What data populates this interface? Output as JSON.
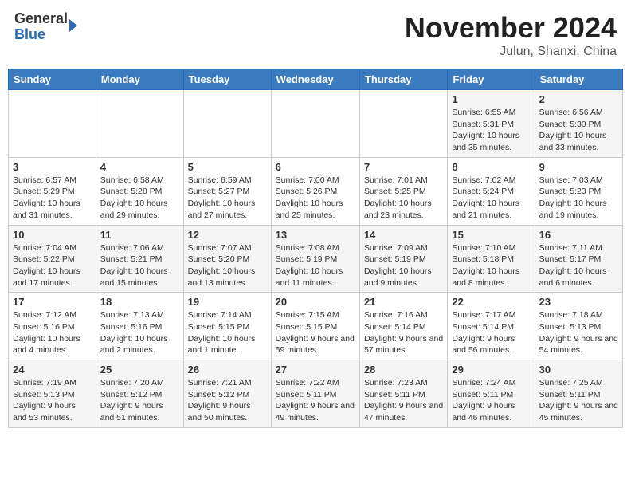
{
  "header": {
    "logo_general": "General",
    "logo_blue": "Blue",
    "month_title": "November 2024",
    "location": "Julun, Shanxi, China"
  },
  "days_of_week": [
    "Sunday",
    "Monday",
    "Tuesday",
    "Wednesday",
    "Thursday",
    "Friday",
    "Saturday"
  ],
  "weeks": [
    [
      {
        "day": "",
        "info": ""
      },
      {
        "day": "",
        "info": ""
      },
      {
        "day": "",
        "info": ""
      },
      {
        "day": "",
        "info": ""
      },
      {
        "day": "",
        "info": ""
      },
      {
        "day": "1",
        "info": "Sunrise: 6:55 AM\nSunset: 5:31 PM\nDaylight: 10 hours and 35 minutes."
      },
      {
        "day": "2",
        "info": "Sunrise: 6:56 AM\nSunset: 5:30 PM\nDaylight: 10 hours and 33 minutes."
      }
    ],
    [
      {
        "day": "3",
        "info": "Sunrise: 6:57 AM\nSunset: 5:29 PM\nDaylight: 10 hours and 31 minutes."
      },
      {
        "day": "4",
        "info": "Sunrise: 6:58 AM\nSunset: 5:28 PM\nDaylight: 10 hours and 29 minutes."
      },
      {
        "day": "5",
        "info": "Sunrise: 6:59 AM\nSunset: 5:27 PM\nDaylight: 10 hours and 27 minutes."
      },
      {
        "day": "6",
        "info": "Sunrise: 7:00 AM\nSunset: 5:26 PM\nDaylight: 10 hours and 25 minutes."
      },
      {
        "day": "7",
        "info": "Sunrise: 7:01 AM\nSunset: 5:25 PM\nDaylight: 10 hours and 23 minutes."
      },
      {
        "day": "8",
        "info": "Sunrise: 7:02 AM\nSunset: 5:24 PM\nDaylight: 10 hours and 21 minutes."
      },
      {
        "day": "9",
        "info": "Sunrise: 7:03 AM\nSunset: 5:23 PM\nDaylight: 10 hours and 19 minutes."
      }
    ],
    [
      {
        "day": "10",
        "info": "Sunrise: 7:04 AM\nSunset: 5:22 PM\nDaylight: 10 hours and 17 minutes."
      },
      {
        "day": "11",
        "info": "Sunrise: 7:06 AM\nSunset: 5:21 PM\nDaylight: 10 hours and 15 minutes."
      },
      {
        "day": "12",
        "info": "Sunrise: 7:07 AM\nSunset: 5:20 PM\nDaylight: 10 hours and 13 minutes."
      },
      {
        "day": "13",
        "info": "Sunrise: 7:08 AM\nSunset: 5:19 PM\nDaylight: 10 hours and 11 minutes."
      },
      {
        "day": "14",
        "info": "Sunrise: 7:09 AM\nSunset: 5:19 PM\nDaylight: 10 hours and 9 minutes."
      },
      {
        "day": "15",
        "info": "Sunrise: 7:10 AM\nSunset: 5:18 PM\nDaylight: 10 hours and 8 minutes."
      },
      {
        "day": "16",
        "info": "Sunrise: 7:11 AM\nSunset: 5:17 PM\nDaylight: 10 hours and 6 minutes."
      }
    ],
    [
      {
        "day": "17",
        "info": "Sunrise: 7:12 AM\nSunset: 5:16 PM\nDaylight: 10 hours and 4 minutes."
      },
      {
        "day": "18",
        "info": "Sunrise: 7:13 AM\nSunset: 5:16 PM\nDaylight: 10 hours and 2 minutes."
      },
      {
        "day": "19",
        "info": "Sunrise: 7:14 AM\nSunset: 5:15 PM\nDaylight: 10 hours and 1 minute."
      },
      {
        "day": "20",
        "info": "Sunrise: 7:15 AM\nSunset: 5:15 PM\nDaylight: 9 hours and 59 minutes."
      },
      {
        "day": "21",
        "info": "Sunrise: 7:16 AM\nSunset: 5:14 PM\nDaylight: 9 hours and 57 minutes."
      },
      {
        "day": "22",
        "info": "Sunrise: 7:17 AM\nSunset: 5:14 PM\nDaylight: 9 hours and 56 minutes."
      },
      {
        "day": "23",
        "info": "Sunrise: 7:18 AM\nSunset: 5:13 PM\nDaylight: 9 hours and 54 minutes."
      }
    ],
    [
      {
        "day": "24",
        "info": "Sunrise: 7:19 AM\nSunset: 5:13 PM\nDaylight: 9 hours and 53 minutes."
      },
      {
        "day": "25",
        "info": "Sunrise: 7:20 AM\nSunset: 5:12 PM\nDaylight: 9 hours and 51 minutes."
      },
      {
        "day": "26",
        "info": "Sunrise: 7:21 AM\nSunset: 5:12 PM\nDaylight: 9 hours and 50 minutes."
      },
      {
        "day": "27",
        "info": "Sunrise: 7:22 AM\nSunset: 5:11 PM\nDaylight: 9 hours and 49 minutes."
      },
      {
        "day": "28",
        "info": "Sunrise: 7:23 AM\nSunset: 5:11 PM\nDaylight: 9 hours and 47 minutes."
      },
      {
        "day": "29",
        "info": "Sunrise: 7:24 AM\nSunset: 5:11 PM\nDaylight: 9 hours and 46 minutes."
      },
      {
        "day": "30",
        "info": "Sunrise: 7:25 AM\nSunset: 5:11 PM\nDaylight: 9 hours and 45 minutes."
      }
    ]
  ]
}
